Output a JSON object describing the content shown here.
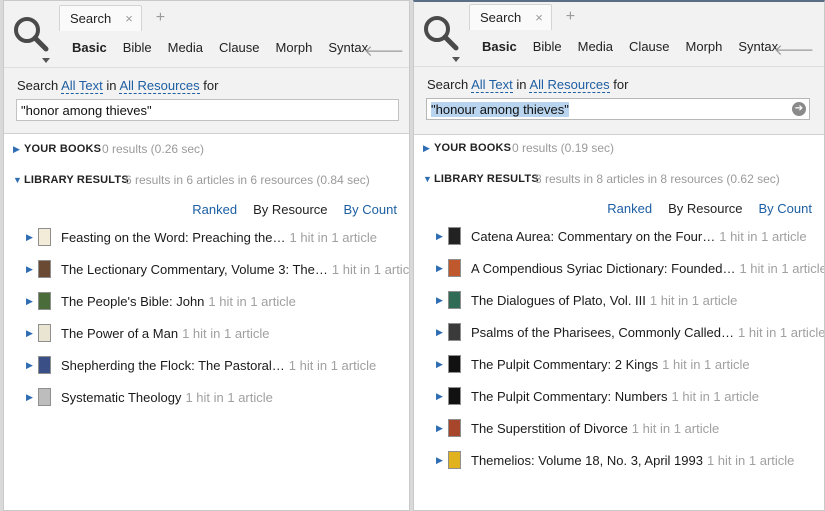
{
  "colors": {
    "accent": "#1d5fa3",
    "muted": "#9a9a9a",
    "selection": "#b9d4ee"
  },
  "panels": [
    {
      "tab_label": "Search",
      "tab_close": "×",
      "tab_add": "+",
      "modes": [
        "Basic",
        "Bible",
        "Media",
        "Clause",
        "Morph",
        "Syntax"
      ],
      "active_mode": "Basic",
      "search_prefix": "Search",
      "scope_text": "All Text",
      "in_word": "in",
      "scope_resources": "All Resources",
      "for_word": "for",
      "query": "\"honor among thieves\"",
      "your_books": {
        "title": "YOUR BOOKS",
        "meta": "0 results (0.26 sec)"
      },
      "library": {
        "title": "LIBRARY RESULTS",
        "meta": "6 results in 6 articles in 6 resources (0.84 sec)"
      },
      "sort": [
        "Ranked",
        "By Resource",
        "By Count"
      ],
      "results": [
        {
          "title": "Feasting on the Word: Preaching the…",
          "hits": "1 hit in 1 article",
          "cover": "#f3ecd9"
        },
        {
          "title": "The Lectionary Commentary, Volume 3: The…",
          "hits": "1 hit in 1 article",
          "cover": "#6b4a34"
        },
        {
          "title": "The People's Bible: John",
          "hits": "1 hit in 1 article",
          "cover": "#4a6b3a"
        },
        {
          "title": "The Power of a Man",
          "hits": "1 hit in 1 article",
          "cover": "#e9e5d2"
        },
        {
          "title": "Shepherding the Flock: The Pastoral…",
          "hits": "1 hit in 1 article",
          "cover": "#3a4f86"
        },
        {
          "title": "Systematic Theology",
          "hits": "1 hit in 1 article",
          "cover": "#bdbdbd"
        }
      ]
    },
    {
      "tab_label": "Search",
      "tab_close": "×",
      "tab_add": "+",
      "modes": [
        "Basic",
        "Bible",
        "Media",
        "Clause",
        "Morph",
        "Syntax"
      ],
      "active_mode": "Basic",
      "search_prefix": "Search",
      "scope_text": "All Text",
      "in_word": "in",
      "scope_resources": "All Resources",
      "for_word": "for",
      "query": "\"honour among thieves\"",
      "go_icon": "➔",
      "your_books": {
        "title": "YOUR BOOKS",
        "meta": "0 results (0.19 sec)"
      },
      "library": {
        "title": "LIBRARY RESULTS",
        "meta": "8 results in 8 articles in 8 resources (0.62 sec)"
      },
      "sort": [
        "Ranked",
        "By Resource",
        "By Count"
      ],
      "results": [
        {
          "title": "Catena Aurea: Commentary on the Four…",
          "hits": "1 hit in 1 article",
          "cover": "#222222"
        },
        {
          "title": "A Compendious Syriac Dictionary: Founded…",
          "hits": "1 hit in 1 article",
          "cover": "#c0582e"
        },
        {
          "title": "The Dialogues of Plato, Vol. III",
          "hits": "1 hit in 1 article",
          "cover": "#2f6b55"
        },
        {
          "title": "Psalms of the Pharisees, Commonly Called…",
          "hits": "1 hit in 1 article",
          "cover": "#3a3a3a"
        },
        {
          "title": "The Pulpit Commentary: 2 Kings",
          "hits": "1 hit in 1 article",
          "cover": "#111111"
        },
        {
          "title": "The Pulpit Commentary: Numbers",
          "hits": "1 hit in 1 article",
          "cover": "#111111"
        },
        {
          "title": "The Superstition of Divorce",
          "hits": "1 hit in 1 article",
          "cover": "#a8462c"
        },
        {
          "title": "Themelios: Volume 18, No. 3, April 1993",
          "hits": "1 hit in 1 article",
          "cover": "#e0b21e"
        }
      ]
    }
  ]
}
